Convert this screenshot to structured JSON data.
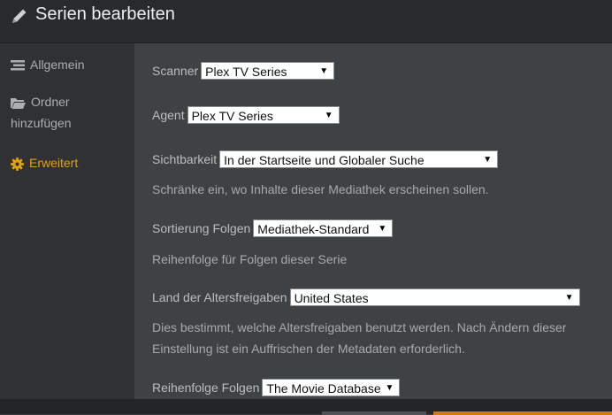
{
  "header": {
    "title": "Serien bearbeiten",
    "icon": "pencil-icon"
  },
  "sidebar": {
    "items": [
      {
        "label": "Allgemein",
        "icon": "list-icon"
      },
      {
        "label_line1": "Ordner",
        "label_line2": "hinzufügen",
        "icon": "folder-icon"
      },
      {
        "label": "Erweitert",
        "icon": "gear-icon",
        "active": true
      }
    ]
  },
  "form": {
    "scanner": {
      "label": "Scanner",
      "value": "Plex TV Series"
    },
    "agent": {
      "label": "Agent",
      "value": "Plex TV Series"
    },
    "visibility": {
      "label": "Sichtbarkeit",
      "value": "In der Startseite und Globaler Suche",
      "help": "Schränke ein, wo Inhalte dieser Mediathek erscheinen sollen."
    },
    "episode_sort": {
      "label": "Sortierung Folgen",
      "value": "Mediathek-Standard",
      "help": "Reihenfolge für Folgen dieser Serie"
    },
    "rating_country": {
      "label": "Land der Altersfreigaben",
      "value": "United States",
      "help_line1": "Dies bestimmt, welche Altersfreigaben benutzt werden. Nach Ändern dieser",
      "help_line2": "Einstellung ist ein Auffrischen der Metadaten erforderlich."
    },
    "episode_order": {
      "label": "Reihenfolge Folgen",
      "value": "The Movie Database"
    }
  },
  "colors": {
    "accent": "#e5a00d",
    "header_bg": "#282a2d",
    "sidebar_bg": "#2f3134",
    "main_bg": "#3f4245",
    "save_button": "#cc7b19"
  }
}
